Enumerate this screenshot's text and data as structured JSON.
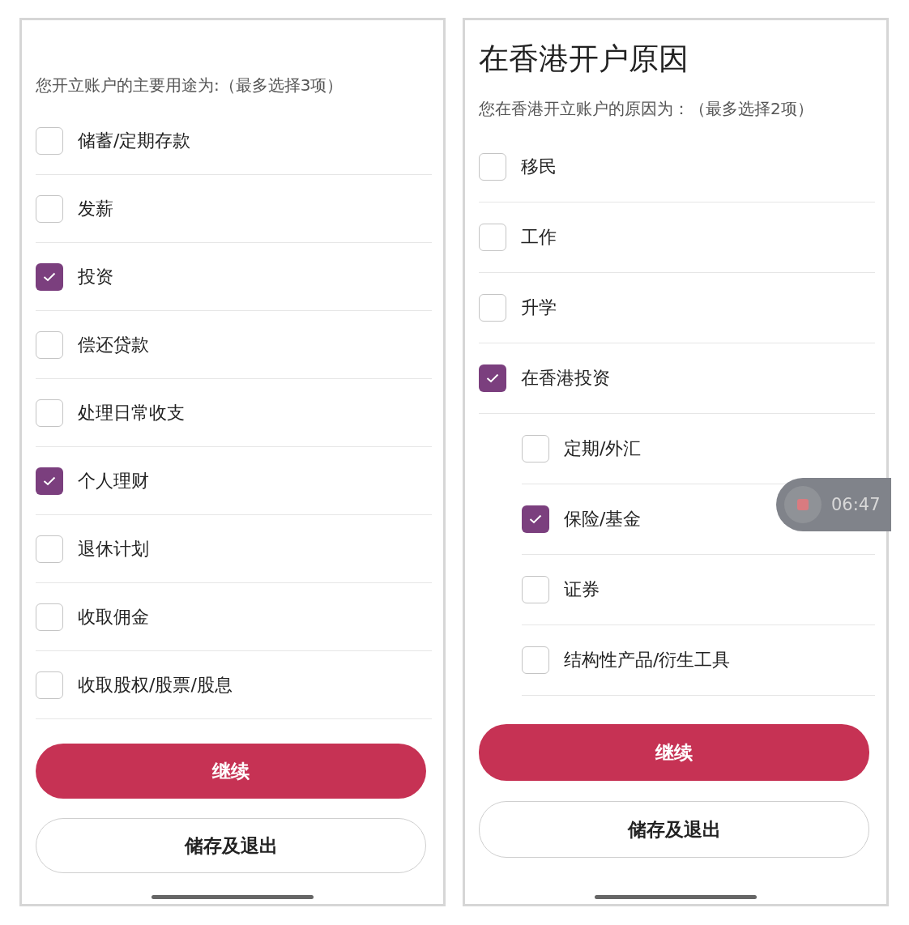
{
  "screens": [
    {
      "subtitle": "您开立账户的主要用途为:（最多选择3项）",
      "options": [
        {
          "label": "储蓄/定期存款",
          "checked": false
        },
        {
          "label": "发薪",
          "checked": false
        },
        {
          "label": "投资",
          "checked": true
        },
        {
          "label": "偿还贷款",
          "checked": false
        },
        {
          "label": "处理日常收支",
          "checked": false
        },
        {
          "label": "个人理财",
          "checked": true
        },
        {
          "label": "退休计划",
          "checked": false
        },
        {
          "label": "收取佣金",
          "checked": false
        },
        {
          "label": "收取股权/股票/股息",
          "checked": false
        }
      ],
      "buttons": [
        {
          "label": "继续",
          "kind": "primary"
        },
        {
          "label": "储存及退出",
          "kind": "secondary"
        }
      ]
    },
    {
      "title": "在香港开户原因",
      "subtitle": "您在香港开立账户的原因为：（最多选择2项）",
      "options": [
        {
          "label": "移民",
          "checked": false
        },
        {
          "label": "工作",
          "checked": false
        },
        {
          "label": "升学",
          "checked": false
        },
        {
          "label": "在香港投资",
          "checked": true,
          "children": [
            {
              "label": "定期/外汇",
              "checked": false
            },
            {
              "label": "保险/基金",
              "checked": true
            },
            {
              "label": "证券",
              "checked": false
            },
            {
              "label": "结构性产品/衍生工具",
              "checked": false
            }
          ]
        }
      ],
      "buttons": [
        {
          "label": "继续",
          "kind": "primary"
        },
        {
          "label": "储存及退出",
          "kind": "secondary"
        }
      ]
    }
  ],
  "recording": {
    "time": "06:47"
  }
}
